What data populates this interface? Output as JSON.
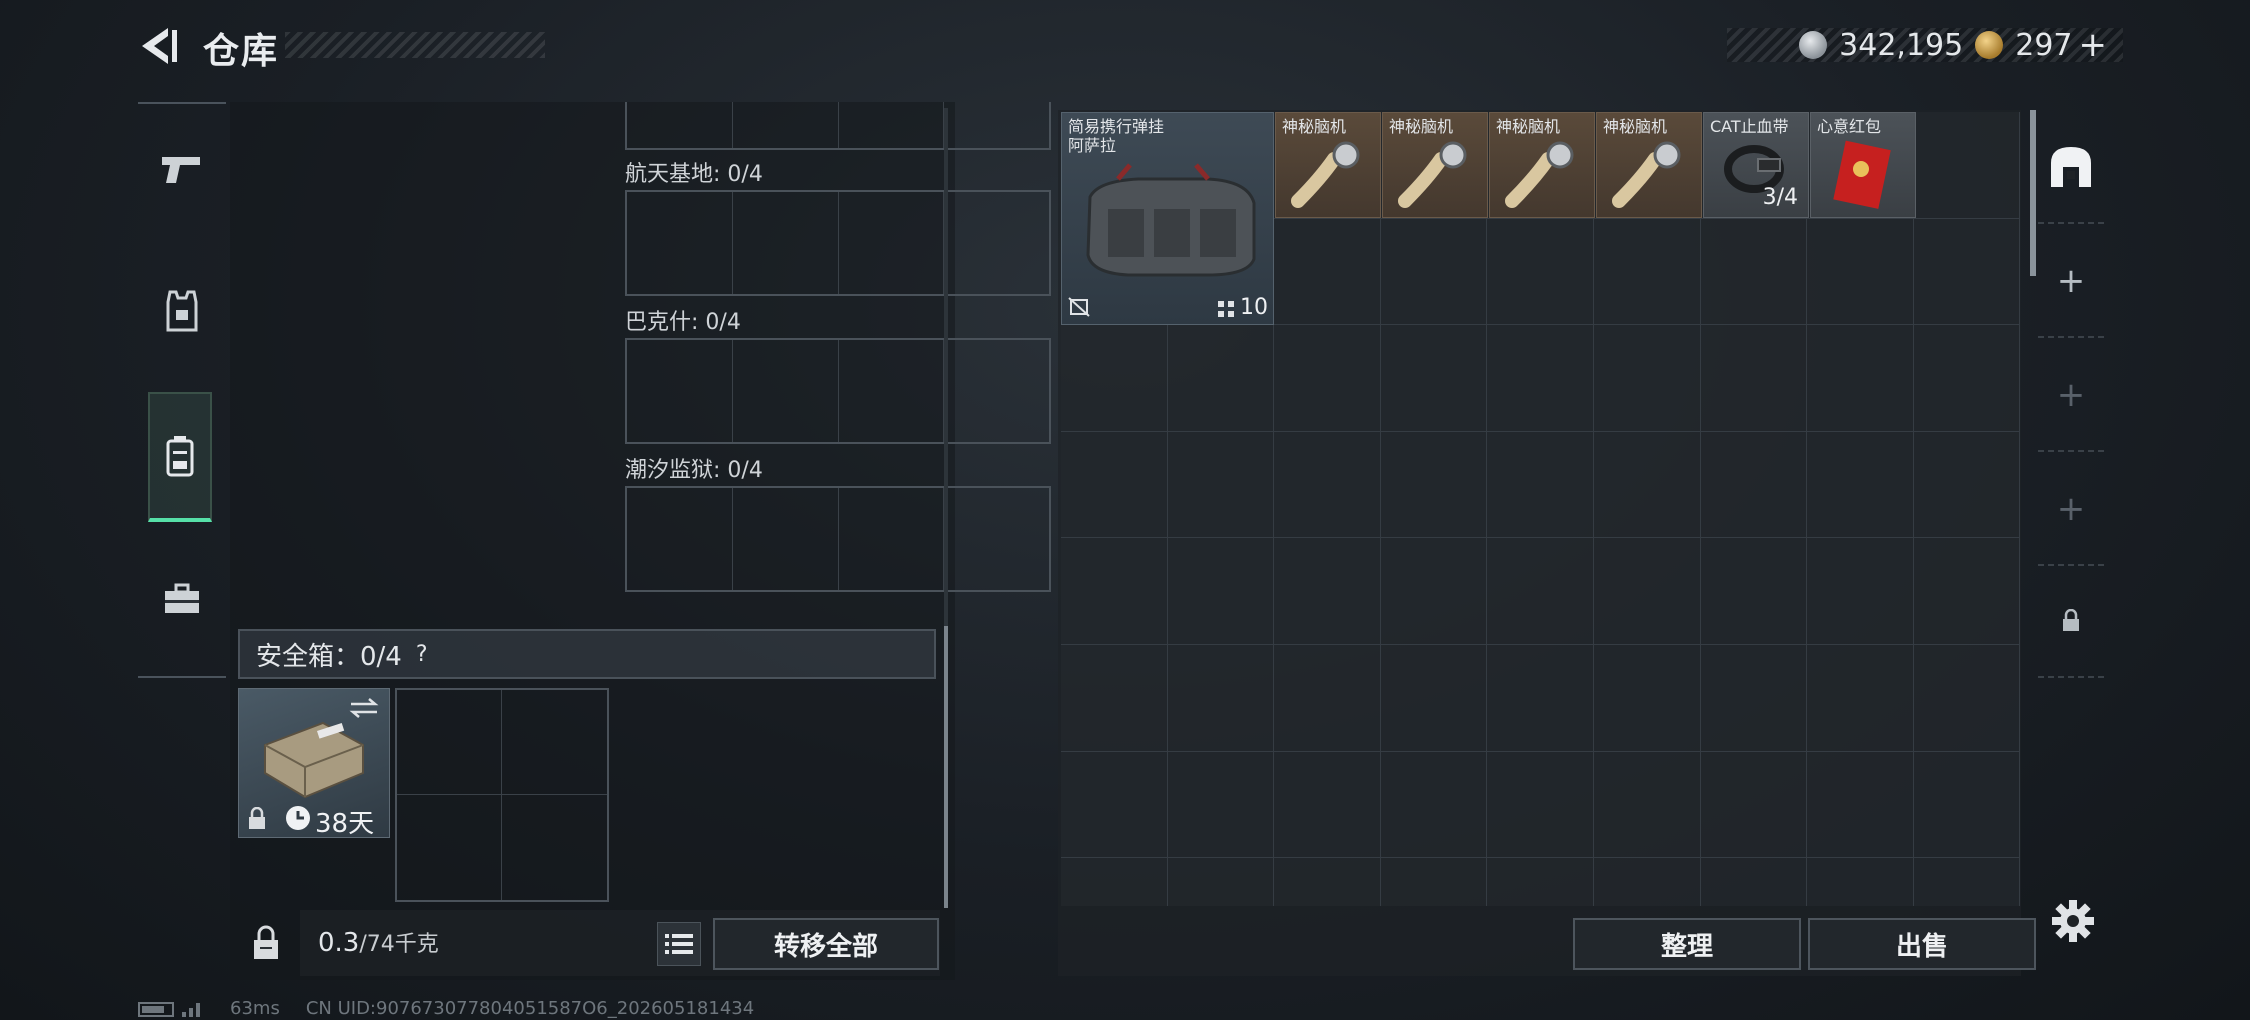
{
  "header": {
    "title": "仓库"
  },
  "currency": [
    {
      "icon": "silver-coin-icon",
      "value": "342,195"
    },
    {
      "icon": "gold-coin-icon",
      "value": "297",
      "plus": "+"
    }
  ],
  "left_nav": [
    {
      "icon": "pistol-icon",
      "active": false
    },
    {
      "icon": "armor-vest-icon",
      "active": false
    },
    {
      "icon": "backpack-icon",
      "active": true
    },
    {
      "icon": "briefcase-icon",
      "active": false
    }
  ],
  "maps": [
    {
      "label": "航天基地: 0/4"
    },
    {
      "label": "巴克什: 0/4"
    },
    {
      "label": "潮汐监狱: 0/4"
    }
  ],
  "safebox": {
    "label": "安全箱：0/4",
    "help": "?",
    "days": "38天"
  },
  "weight": {
    "value": "0.3",
    "unit": "/74千克"
  },
  "buttons": {
    "transfer_all": "转移全部",
    "sort": "整理",
    "sell": "出售"
  },
  "items": [
    {
      "name_line1": "简易携行弹挂",
      "name_line2": "阿萨拉",
      "count": "10"
    },
    {
      "name": "神秘脑机"
    },
    {
      "name": "神秘脑机"
    },
    {
      "name": "神秘脑机"
    },
    {
      "name": "神秘脑机"
    },
    {
      "name": "CAT止血带",
      "stack": "3/4"
    },
    {
      "name": "心意红包"
    }
  ],
  "status": {
    "ping": "63ms",
    "uid": "CN UID:907673077804051587O6_202605181434"
  },
  "colors": {
    "accent_green": "#56e0a8",
    "panel": "#1e2226",
    "orange_rarity": "#5a4a3a"
  }
}
